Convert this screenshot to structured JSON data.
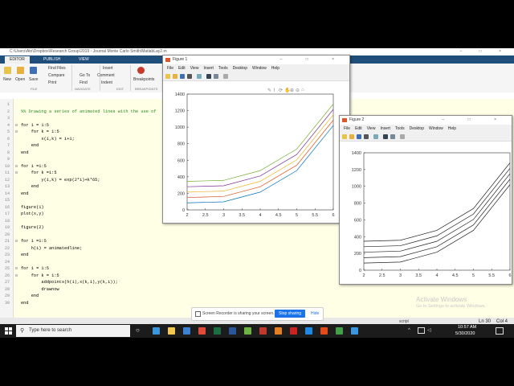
{
  "matlab": {
    "title_path": "C:\\Users\\Ato\\Dropbox\\Research Group\\2019 - Journal Monte Carlo Smith\\MatlabLay2.m",
    "window_controls": [
      "–",
      "□",
      "×"
    ],
    "tabs": [
      "EDITOR",
      "PUBLISH",
      "VIEW"
    ],
    "ribbon": {
      "new": "New",
      "open": "Open",
      "save": "Save",
      "find_files": "Find Files",
      "compare": "Compare",
      "print": "Print",
      "go_to": "Go To",
      "find": "Find",
      "insert": "Insert",
      "comment": "Comment",
      "indent": "Indent",
      "breakpoints": "Breakpoints",
      "sections": [
        "FILE",
        "NAVIGATE",
        "EDIT",
        "BREAKPOINTS"
      ]
    },
    "editor_lines": [
      {
        "n": "1",
        "text": ""
      },
      {
        "n": "2",
        "text": "%% Drawing a series of animated lines with the use of",
        "type": "comment"
      },
      {
        "n": "3",
        "text": ""
      },
      {
        "n": "4",
        "text": "for i = 1:5",
        "fold": "-"
      },
      {
        "n": "5",
        "text": "    for k = 1:5",
        "fold": "-"
      },
      {
        "n": "6",
        "text": "        x(i,k) = i+1;"
      },
      {
        "n": "7",
        "text": "    end"
      },
      {
        "n": "8",
        "text": "end"
      },
      {
        "n": "9",
        "text": ""
      },
      {
        "n": "10",
        "text": "for i =1:5",
        "fold": "-"
      },
      {
        "n": "11",
        "text": "    for k =1:5",
        "fold": "-"
      },
      {
        "n": "12",
        "text": "        y(i,k) = exp(2*i)+k*65;"
      },
      {
        "n": "13",
        "text": "    end"
      },
      {
        "n": "14",
        "text": "end"
      },
      {
        "n": "15",
        "text": ""
      },
      {
        "n": "16",
        "text": "figure(1)"
      },
      {
        "n": "17",
        "text": "plot(x,y)"
      },
      {
        "n": "18",
        "text": ""
      },
      {
        "n": "19",
        "text": "figure(2)"
      },
      {
        "n": "20",
        "text": ""
      },
      {
        "n": "21",
        "text": "for i =1:5",
        "fold": "-"
      },
      {
        "n": "22",
        "text": "    h(i) = animatedline;"
      },
      {
        "n": "23",
        "text": "end"
      },
      {
        "n": "24",
        "text": ""
      },
      {
        "n": "25",
        "text": "for i = 1:5",
        "fold": "-"
      },
      {
        "n": "26",
        "text": "    for k = 1:5",
        "fold": "-"
      },
      {
        "n": "27",
        "text": "        addpoints(h(i),x(k,i),y(k,i));"
      },
      {
        "n": "28",
        "text": "        drawnow"
      },
      {
        "n": "29",
        "text": "    end"
      },
      {
        "n": "30",
        "text": "end"
      }
    ],
    "status": {
      "mode": "script",
      "ln": "Ln 30",
      "col": "Col 4"
    }
  },
  "figure1": {
    "title": "Figure 1",
    "menu": [
      "File",
      "Edit",
      "View",
      "Insert",
      "Tools",
      "Desktop",
      "Window",
      "Help"
    ]
  },
  "figure2": {
    "title": "Figure 2",
    "menu": [
      "File",
      "Edit",
      "View",
      "Insert",
      "Tools",
      "Desktop",
      "Window",
      "Help"
    ]
  },
  "chart_data": [
    {
      "type": "line",
      "x": [
        2,
        3,
        4,
        5,
        6
      ],
      "xlim": [
        2,
        6
      ],
      "ylim": [
        0,
        1400
      ],
      "xticks": [
        "2",
        "2.5",
        "3",
        "3.5",
        "4",
        "4.5",
        "5",
        "5.5",
        "6"
      ],
      "yticks": [
        "0",
        "200",
        "400",
        "600",
        "800",
        "1000",
        "1200",
        "1400"
      ],
      "series": [
        {
          "values": [
            85,
            97,
            215,
            475,
            1020
          ],
          "color": "#0072bd"
        },
        {
          "values": [
            150,
            162,
            280,
            540,
            1085
          ],
          "color": "#d95319"
        },
        {
          "values": [
            215,
            227,
            345,
            605,
            1150
          ],
          "color": "#edb120"
        },
        {
          "values": [
            280,
            292,
            410,
            670,
            1215
          ],
          "color": "#7e2f8e"
        },
        {
          "values": [
            345,
            357,
            475,
            735,
            1280
          ],
          "color": "#77ac30"
        }
      ]
    },
    {
      "type": "line",
      "x": [
        2,
        3,
        4,
        5,
        6
      ],
      "xlim": [
        2,
        6
      ],
      "ylim": [
        0,
        1400
      ],
      "xticks": [
        "2",
        "2.5",
        "3",
        "3.5",
        "4",
        "4.5",
        "5",
        "5.5",
        "6"
      ],
      "yticks": [
        "0",
        "200",
        "400",
        "600",
        "800",
        "1000",
        "1200",
        "1400"
      ],
      "series": [
        {
          "values": [
            85,
            97,
            215,
            475,
            1020
          ],
          "color": "#222222"
        },
        {
          "values": [
            150,
            162,
            280,
            540,
            1085
          ],
          "color": "#222222"
        },
        {
          "values": [
            215,
            227,
            345,
            605,
            1150
          ],
          "color": "#222222"
        },
        {
          "values": [
            280,
            292,
            410,
            670,
            1215
          ],
          "color": "#222222"
        },
        {
          "values": [
            345,
            357,
            475,
            735,
            1280
          ],
          "color": "#222222"
        }
      ]
    }
  ],
  "share_bar": {
    "text": "Screen Recorder is sharing your screen.",
    "stop": "Stop sharing",
    "hide": "Hide"
  },
  "watermark": {
    "line1": "Activate Windows",
    "line2": "Go to Settings to activate Windows."
  },
  "taskbar": {
    "search_placeholder": "Type here to search",
    "time": "10:57 AM",
    "date": "5/30/2020",
    "app_colors": [
      "#3a96dd",
      "#f2c94c",
      "#3c82d4",
      "#e04b3a",
      "#1d6f42",
      "#2b579a",
      "#6cb33f",
      "#c0392b",
      "#e67e22",
      "#cc2222",
      "#1e88e5",
      "#e64a19",
      "#43a047",
      "#3a96dd"
    ]
  }
}
